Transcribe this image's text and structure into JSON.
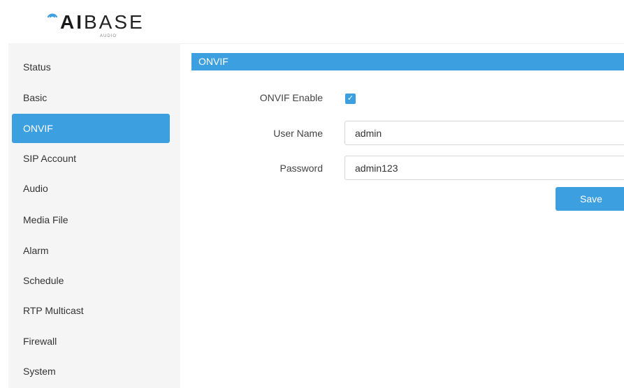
{
  "brand": {
    "name_bold": "AI",
    "name_light": "BASE",
    "tagline": "AUDIO",
    "accent_color": "#3c9fe0",
    "logo_icon": "sound-wave-icon"
  },
  "sidebar": {
    "items": [
      {
        "label": "Status",
        "active": false
      },
      {
        "label": "Basic",
        "active": false
      },
      {
        "label": "ONVIF",
        "active": true
      },
      {
        "label": "SIP Account",
        "active": false
      },
      {
        "label": "Audio",
        "active": false
      },
      {
        "label": "Media File",
        "active": false
      },
      {
        "label": "Alarm",
        "active": false
      },
      {
        "label": "Schedule",
        "active": false
      },
      {
        "label": "RTP Multicast",
        "active": false
      },
      {
        "label": "Firewall",
        "active": false
      },
      {
        "label": "System",
        "active": false
      }
    ]
  },
  "main": {
    "section_title": "ONVIF",
    "form": {
      "enable": {
        "label": "ONVIF Enable",
        "checked": true,
        "check_glyph": "✓"
      },
      "username": {
        "label": "User Name",
        "value": "admin"
      },
      "password": {
        "label": "Password",
        "value": "admin123"
      },
      "save_label": "Save"
    }
  }
}
